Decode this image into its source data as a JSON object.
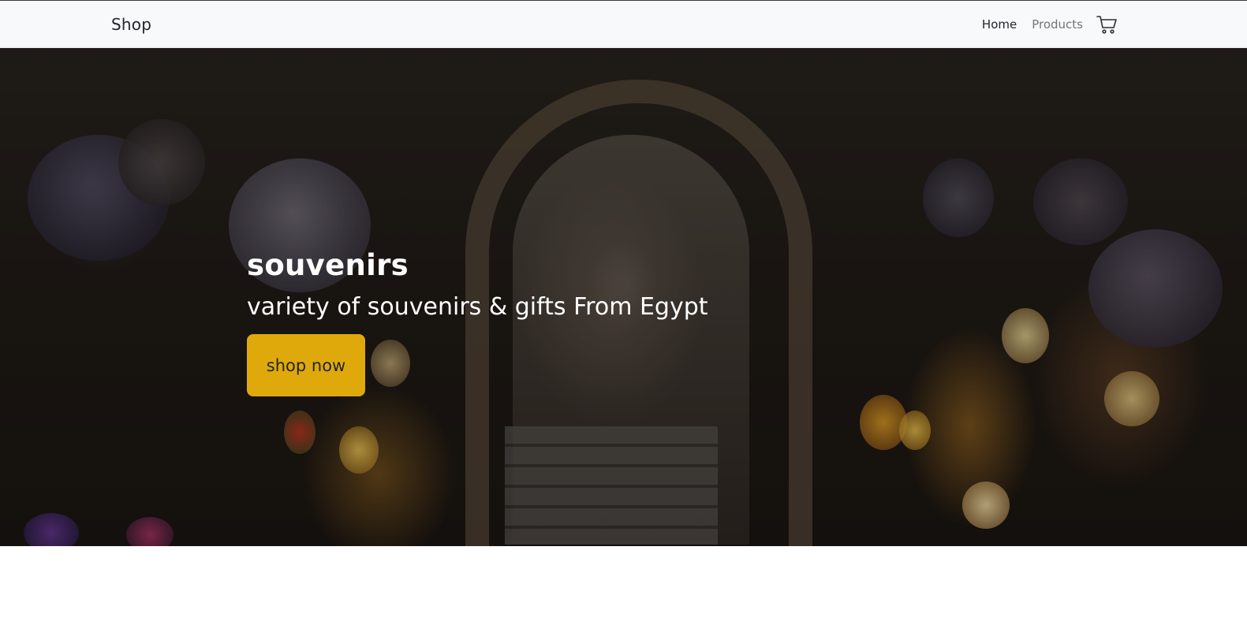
{
  "navbar": {
    "brand": "Shop",
    "links": [
      {
        "label": "Home",
        "active": true
      },
      {
        "label": "Products",
        "active": false
      }
    ],
    "cart_icon": "cart-icon"
  },
  "hero": {
    "title": "souvenirs",
    "subtitle": "variety of souvenirs & gifts From Egypt",
    "cta_label": "shop now",
    "background": "bazaar-archway-with-lanterns-photo"
  },
  "colors": {
    "navbar_bg": "#f8f9fa",
    "cta_bg": "#e0a90b",
    "hero_text": "#ffffff"
  }
}
